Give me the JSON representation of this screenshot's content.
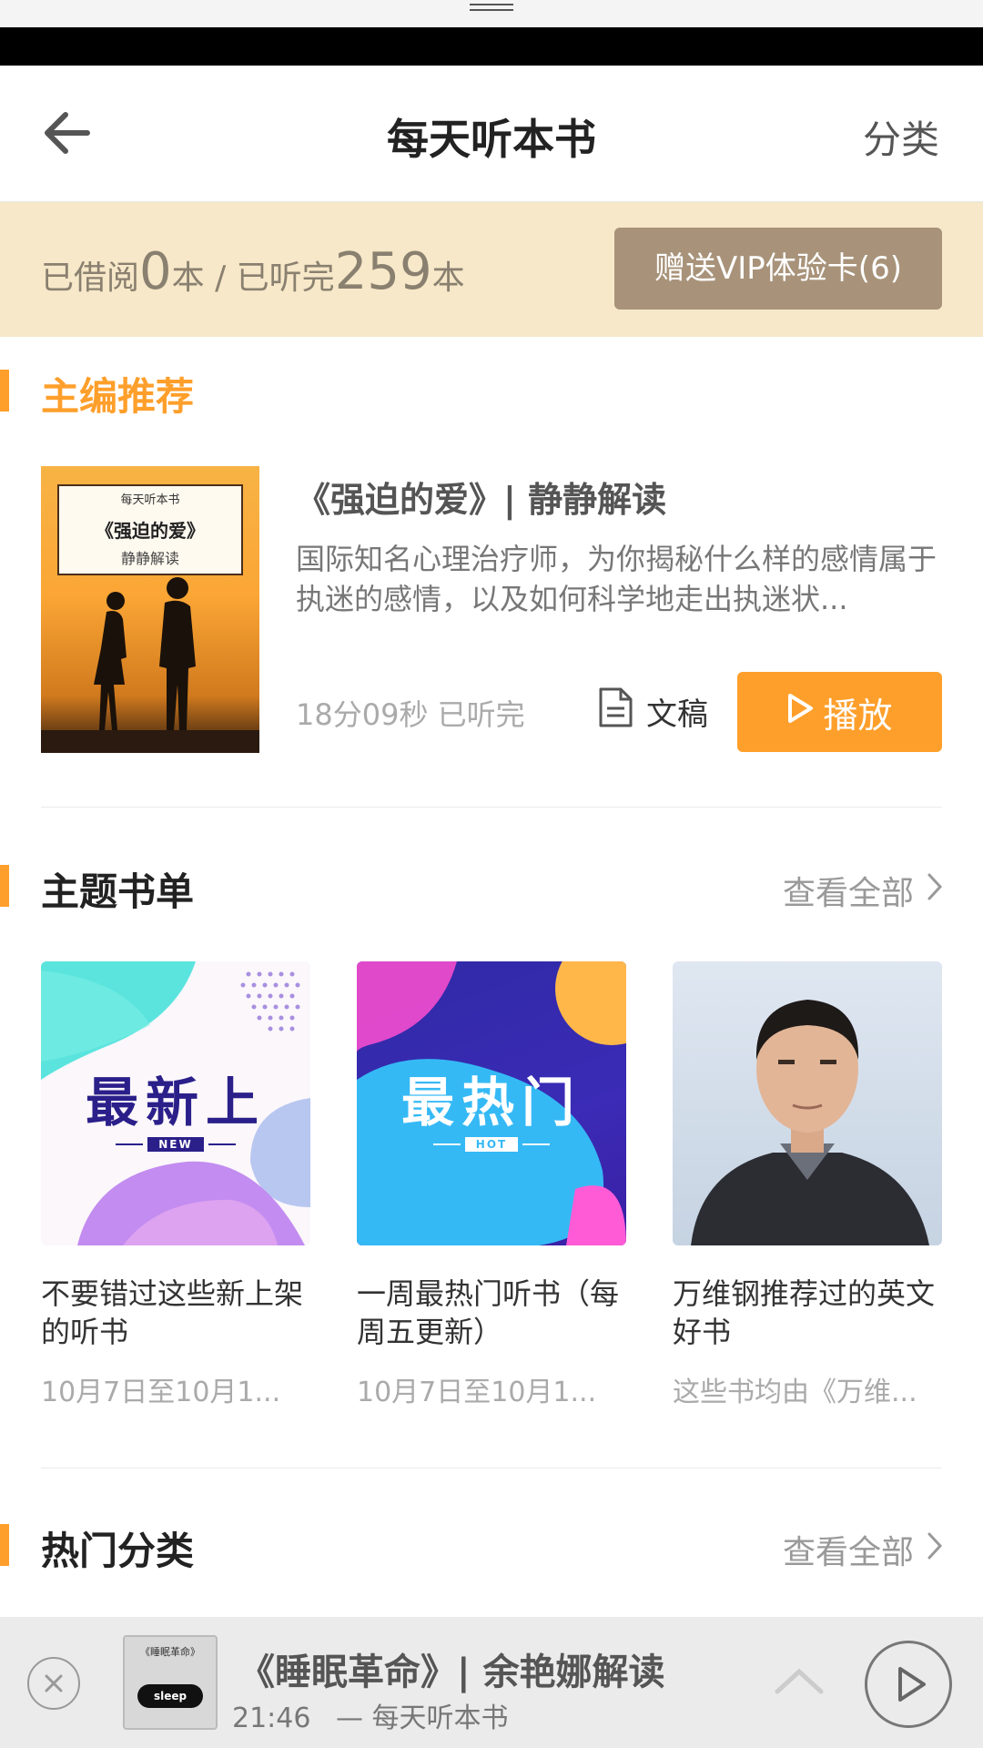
{
  "nav": {
    "title": "每天听本书",
    "right_label": "分类"
  },
  "status": {
    "borrowed_prefix": "已借阅",
    "borrowed_count": "0",
    "borrowed_unit": "本 / 已听完",
    "finished_count": "259",
    "finished_unit": "本",
    "vip_button": "赠送VIP体验卡(6)"
  },
  "editor_pick": {
    "section_title": "主编推荐",
    "cover": {
      "brand": "每天听本书",
      "title": "《强迫的爱》",
      "subtitle": "静静解读"
    },
    "title": "《强迫的爱》| 静静解读",
    "description": "国际知名心理治疗师，为你揭秘什么样的感情属于执迷的感情，以及如何科学地走出执迷状...",
    "duration": "18分09秒",
    "status": "已听完",
    "script_label": "文稿",
    "play_label": "播放"
  },
  "booklists": {
    "section_title": "主题书单",
    "see_all": "查看全部",
    "items": [
      {
        "image_text": "最新上",
        "image_tag": "NEW",
        "title": "不要错过这些新上架的听书",
        "subtitle": "10月7日至10月1..."
      },
      {
        "image_text": "最热门",
        "image_tag": "HOT",
        "title": "一周最热门听书（每周五更新）",
        "subtitle": "10月7日至10月1..."
      },
      {
        "title": "万维钢推荐过的英文好书",
        "subtitle": "这些书均由《万维..."
      }
    ]
  },
  "categories": {
    "section_title": "热门分类",
    "see_all": "查看全部"
  },
  "player": {
    "cover_text": "《睡眠革命》",
    "cover_badge": "sleep",
    "title": "《睡眠革命》| 余艳娜解读",
    "time": "21:46",
    "source": "— 每天听本书"
  },
  "colors": {
    "accent": "#ff9f2b",
    "status_band": "#f6e8c8",
    "vip_button": "#a8937a",
    "player_bg": "#ebebeb"
  },
  "icons": [
    "back-arrow-icon",
    "document-icon",
    "play-triangle-icon",
    "chevron-right-icon",
    "close-circle-icon",
    "chevron-up-icon",
    "play-circle-icon"
  ]
}
